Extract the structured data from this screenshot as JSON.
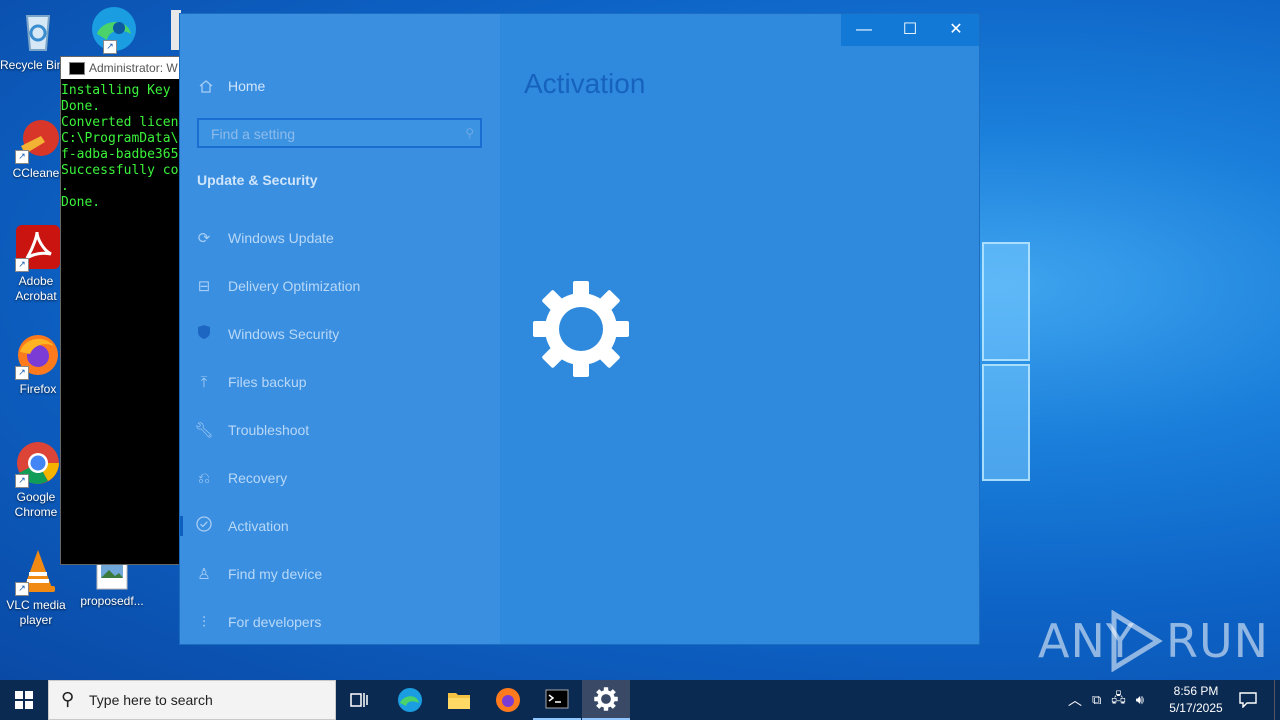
{
  "desktop": {
    "icons": [
      {
        "label": "Recycle Bin",
        "icon": "recycle-bin-icon"
      },
      {
        "label": "CCleaner",
        "icon": "ccleaner-icon"
      },
      {
        "label": "Adobe Acrobat",
        "icon": "adobe-acrobat-icon"
      },
      {
        "label": "Firefox",
        "icon": "firefox-icon"
      },
      {
        "label": "Google Chrome",
        "icon": "chrome-icon"
      },
      {
        "label": "VLC media player",
        "icon": "vlc-icon"
      },
      {
        "label": "proposedf...",
        "icon": "image-file-icon"
      }
    ],
    "watermark": "ANY RUN"
  },
  "cmd": {
    "title": "Administrator: W",
    "lines": "Installing Key\nDone.\nConverted licen\nC:\\ProgramData\\\nf-adba-badbe365\nSuccessfully co\n.\nDone."
  },
  "settings": {
    "window_controls": {
      "minimize": "—",
      "maximize": "☐",
      "close": "✕"
    },
    "home": "Home",
    "search_placeholder": "Find a setting",
    "section": "Update & Security",
    "nav_items": [
      {
        "label": "Windows Update",
        "icon": "refresh-icon"
      },
      {
        "label": "Delivery Optimization",
        "icon": "delivery-icon"
      },
      {
        "label": "Windows Security",
        "icon": "shield-icon"
      },
      {
        "label": "Files backup",
        "icon": "upload-arrow-icon"
      },
      {
        "label": "Troubleshoot",
        "icon": "wrench-icon"
      },
      {
        "label": "Recovery",
        "icon": "recovery-icon"
      },
      {
        "label": "Activation",
        "icon": "check-circle-icon",
        "active": true
      },
      {
        "label": "Find my device",
        "icon": "person-location-icon"
      },
      {
        "label": "For developers",
        "icon": "developer-icon"
      }
    ],
    "page_title": "Activation",
    "colors": {
      "title": "#1662bd",
      "window": "#2f8ade",
      "nav": "#3b8fe0"
    }
  },
  "taskbar": {
    "search_placeholder": "Type here to search",
    "time": "8:56 PM",
    "date": "5/17/2025"
  }
}
